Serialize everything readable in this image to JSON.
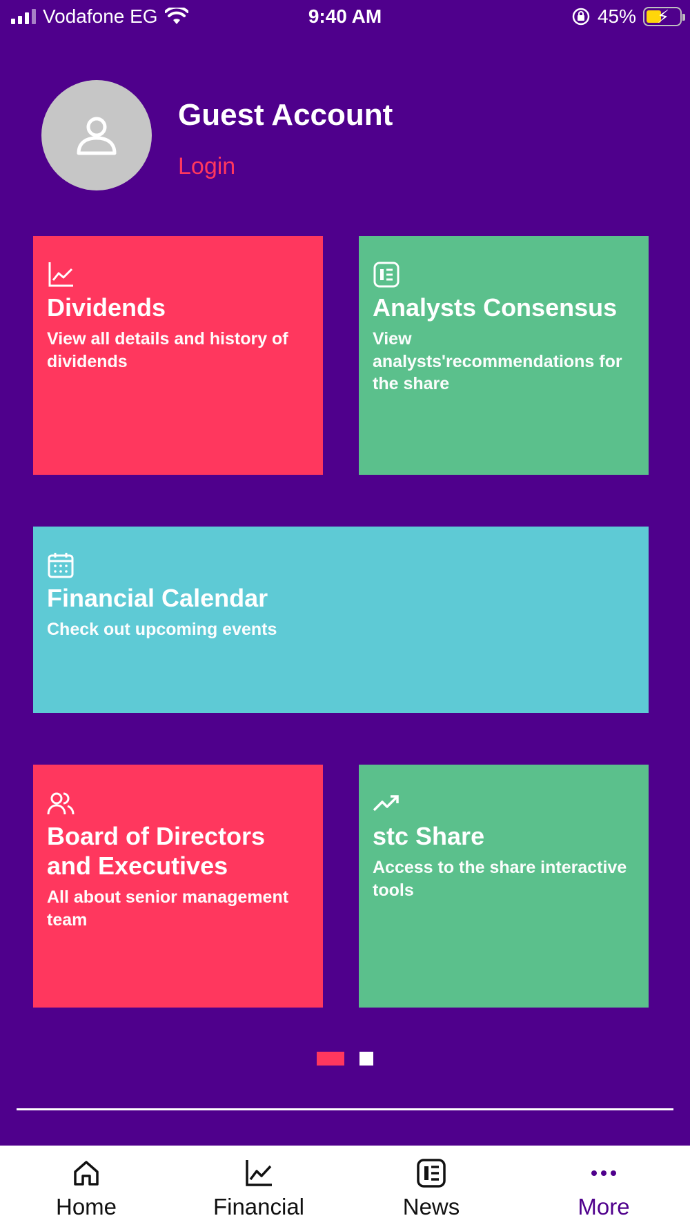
{
  "status_bar": {
    "carrier": "Vodafone EG",
    "time": "9:40 AM",
    "battery": "45%",
    "battery_level": 0.45
  },
  "profile": {
    "name": "Guest Account",
    "login_label": "Login"
  },
  "cards": {
    "dividends": {
      "title": "Dividends",
      "desc": "View all details and history of dividends",
      "icon": "chart-line-icon"
    },
    "analysts": {
      "title": "Analysts Consensus",
      "desc": "View analysts'recommendations for the share",
      "icon": "news-icon"
    },
    "calendar": {
      "title": "Financial Calendar",
      "desc": "Check out upcoming events",
      "icon": "calendar-icon"
    },
    "board": {
      "title": "Board of Directors and Executives",
      "desc": "All about senior management team",
      "icon": "users-icon"
    },
    "share": {
      "title": "stc Share",
      "desc": "Access to the share interactive tools",
      "icon": "trending-up-icon"
    }
  },
  "pager": {
    "current_page": 1,
    "total_pages": 2
  },
  "bottom_nav": {
    "items": [
      {
        "label": "Home",
        "icon": "home-icon"
      },
      {
        "label": "Financial",
        "icon": "chart-line-icon"
      },
      {
        "label": "News",
        "icon": "news-icon"
      },
      {
        "label": "More",
        "icon": "more-icon"
      }
    ],
    "active": "More"
  },
  "colors": {
    "background": "#4f008c",
    "accent_red": "#ff375e",
    "accent_green": "#5bc08c",
    "accent_teal": "#5ecad5",
    "avatar_bg": "#c6c6c6"
  }
}
